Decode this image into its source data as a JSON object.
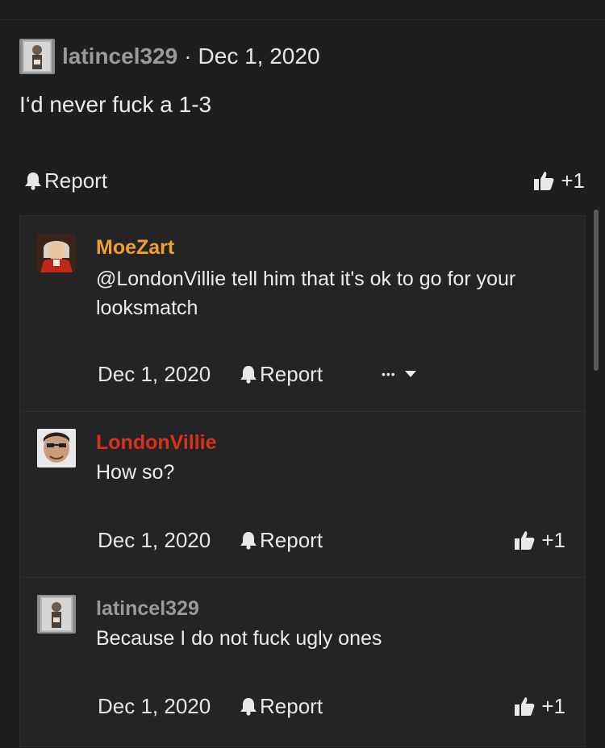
{
  "post": {
    "author": "latincel329",
    "separator": "·",
    "date": "Dec 1, 2020",
    "body": "I‘d never fuck a 1-3",
    "report_label": "Report",
    "reaction_label": "+1"
  },
  "replies": [
    {
      "author": "MoeZart",
      "author_color": "#f0a030",
      "text": "@LondonVillie tell him that it's ok to go for your looksmatch",
      "date": "Dec 1, 2020",
      "report_label": "Report",
      "more_label": "•••"
    },
    {
      "author": "LondonVillie",
      "author_color": "#d9301e",
      "text": "How so?",
      "date": "Dec 1, 2020",
      "report_label": "Report",
      "reaction_label": "+1"
    },
    {
      "author": "latincel329",
      "author_color": "#9a9a9a",
      "text": "Because I do not fuck ugly ones",
      "date": "Dec 1, 2020",
      "report_label": "Report",
      "reaction_label": "+1"
    }
  ]
}
